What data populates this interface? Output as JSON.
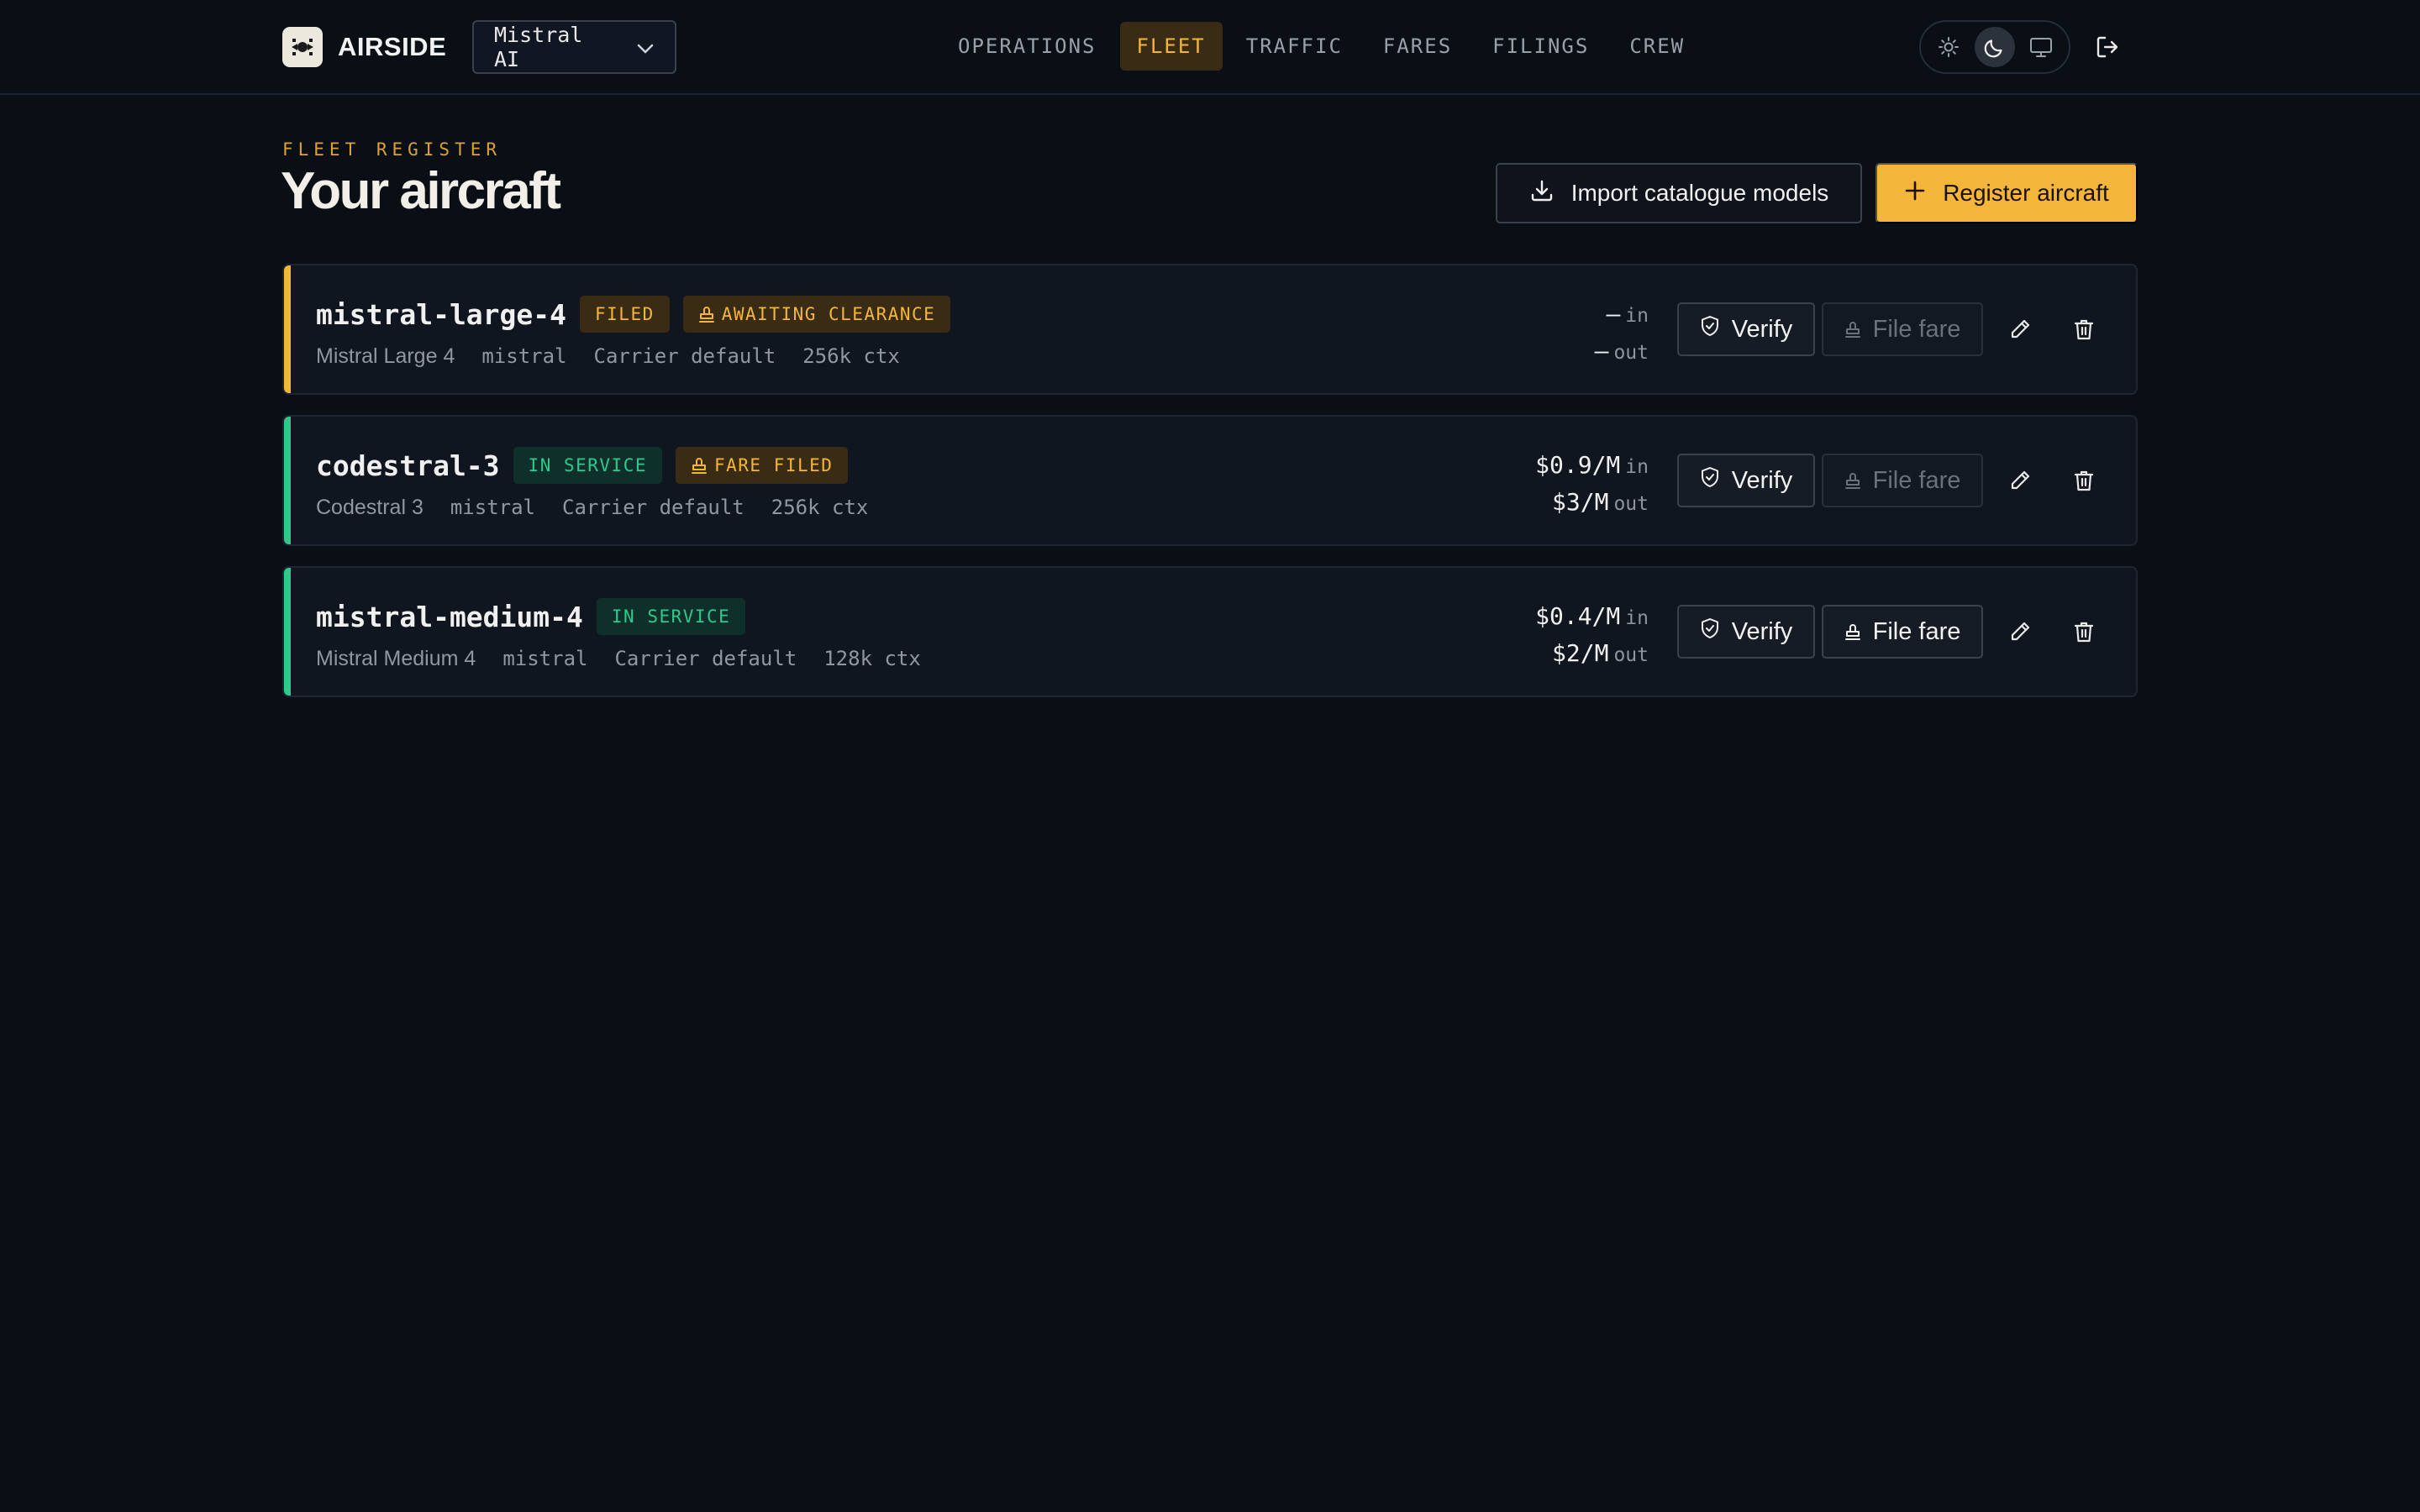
{
  "header": {
    "brand_name": "AIRSIDE",
    "org_select_value": "Mistral AI",
    "nav": [
      {
        "label": "OPERATIONS",
        "active": false
      },
      {
        "label": "FLEET",
        "active": true
      },
      {
        "label": "TRAFFIC",
        "active": false
      },
      {
        "label": "FARES",
        "active": false
      },
      {
        "label": "FILINGS",
        "active": false
      },
      {
        "label": "CREW",
        "active": false
      }
    ],
    "theme_options": [
      "sun-icon",
      "moon-icon",
      "monitor-icon"
    ],
    "theme_selected": "moon-icon",
    "logout_icon": "logout-icon"
  },
  "page": {
    "eyebrow": "FLEET REGISTER",
    "title": "Your aircraft",
    "import_label": "Import catalogue models",
    "register_label": "Register aircraft"
  },
  "colors": {
    "accent": "#f4b63a",
    "success": "#2fc98b",
    "background": "#0a0f16",
    "card": "#10161f"
  },
  "aircraft": [
    {
      "id": "mistral-large-4",
      "status_color": "#f4b63a",
      "badges": [
        {
          "label": "FILED",
          "tone": "amber",
          "icon": ""
        },
        {
          "label": "AWAITING CLEARANCE",
          "tone": "amber",
          "icon": "stamp-icon"
        }
      ],
      "display_name": "Mistral Large 4",
      "provider": "mistral",
      "carrier": "Carrier default",
      "context": "256k ctx",
      "price_in": "—",
      "price_in_unit": "in",
      "price_out": "—",
      "price_out_unit": "out",
      "verify_label": "Verify",
      "file_fare_label": "File fare",
      "file_fare_enabled": false
    },
    {
      "id": "codestral-3",
      "status_color": "#2fc98b",
      "badges": [
        {
          "label": "IN SERVICE",
          "tone": "green",
          "icon": ""
        },
        {
          "label": "FARE FILED",
          "tone": "amber",
          "icon": "stamp-icon"
        }
      ],
      "display_name": "Codestral 3",
      "provider": "mistral",
      "carrier": "Carrier default",
      "context": "256k ctx",
      "price_in": "$0.9/M",
      "price_in_unit": "in",
      "price_out": "$3/M",
      "price_out_unit": "out",
      "verify_label": "Verify",
      "file_fare_label": "File fare",
      "file_fare_enabled": false
    },
    {
      "id": "mistral-medium-4",
      "status_color": "#2fc98b",
      "badges": [
        {
          "label": "IN SERVICE",
          "tone": "green",
          "icon": ""
        }
      ],
      "display_name": "Mistral Medium 4",
      "provider": "mistral",
      "carrier": "Carrier default",
      "context": "128k ctx",
      "price_in": "$0.4/M",
      "price_in_unit": "in",
      "price_out": "$2/M",
      "price_out_unit": "out",
      "verify_label": "Verify",
      "file_fare_label": "File fare",
      "file_fare_enabled": true
    }
  ]
}
